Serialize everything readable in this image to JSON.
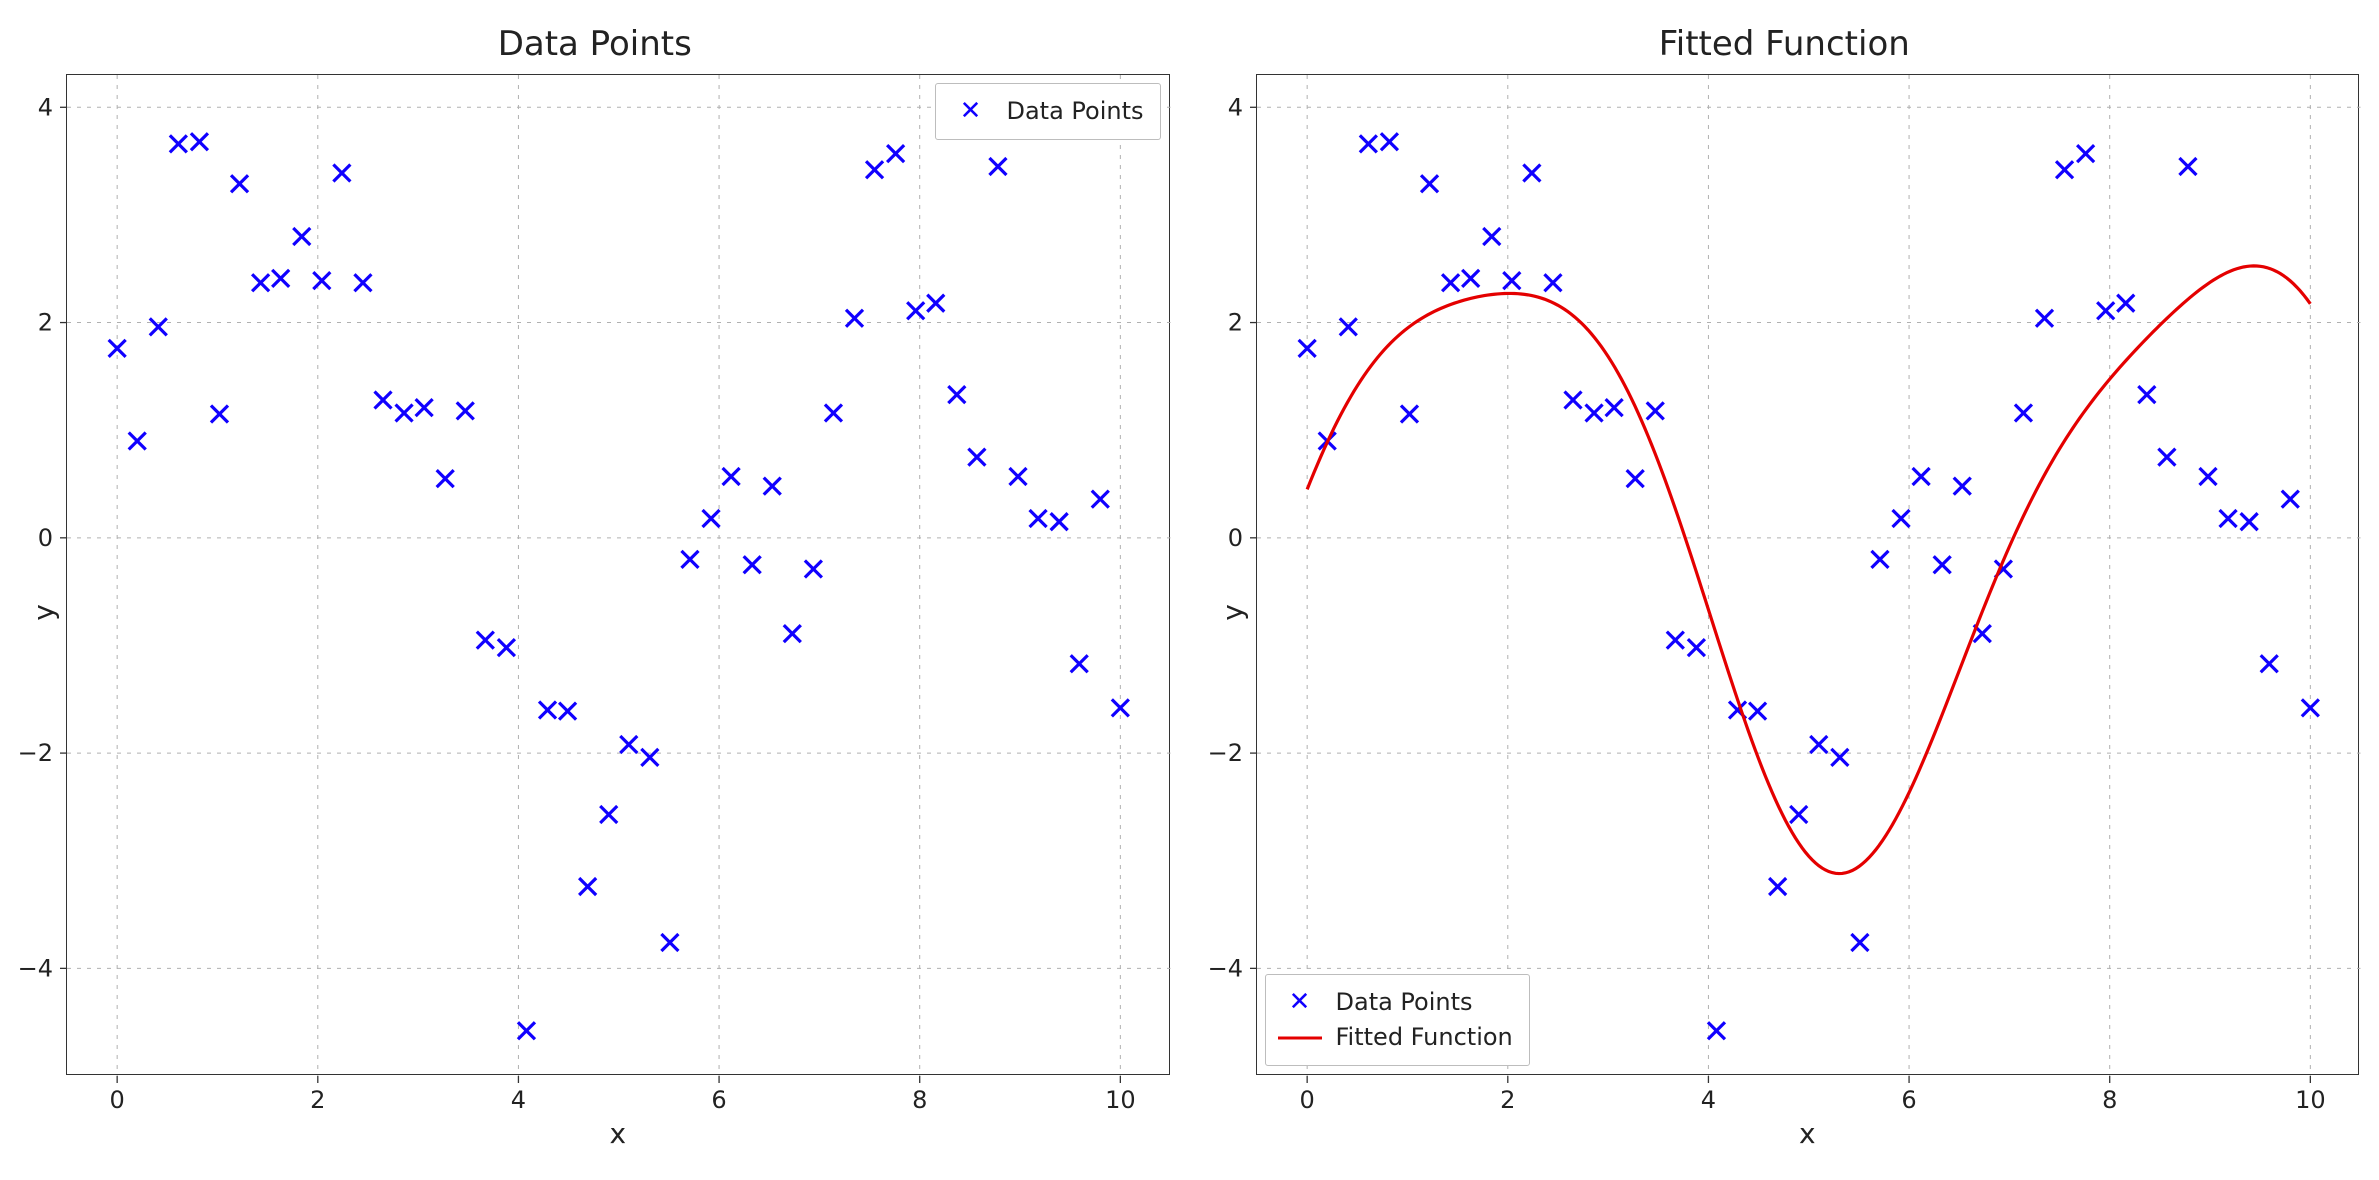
{
  "chart_data": [
    {
      "type": "scatter",
      "title": "Data Points",
      "xlabel": "x",
      "ylabel": "y",
      "xlim": [
        -0.5,
        10.5
      ],
      "ylim": [
        -5.0,
        4.3
      ],
      "xticks": [
        0,
        2,
        4,
        6,
        8,
        10
      ],
      "yticks": [
        -4,
        -2,
        0,
        2,
        4
      ],
      "legend": {
        "position": "upper right",
        "entries": [
          "Data Points"
        ]
      },
      "x": [
        0.0,
        0.2,
        0.41,
        0.61,
        0.82,
        1.02,
        1.22,
        1.43,
        1.63,
        1.84,
        2.04,
        2.24,
        2.45,
        2.65,
        2.86,
        3.06,
        3.27,
        3.47,
        3.67,
        3.88,
        4.08,
        4.29,
        4.49,
        4.69,
        4.9,
        5.1,
        5.31,
        5.51,
        5.71,
        5.92,
        6.12,
        6.33,
        6.53,
        6.73,
        6.94,
        7.14,
        7.35,
        7.55,
        7.76,
        7.96,
        8.16,
        8.37,
        8.57,
        8.78,
        8.98,
        9.18,
        9.39,
        9.59,
        9.8,
        10.0
      ],
      "y": [
        1.76,
        0.9,
        1.96,
        3.66,
        3.68,
        1.15,
        3.29,
        2.37,
        2.41,
        2.8,
        2.39,
        3.39,
        2.37,
        1.28,
        1.16,
        1.21,
        0.55,
        1.18,
        -0.95,
        -1.02,
        -4.58,
        -1.6,
        -1.61,
        -3.24,
        -2.57,
        -1.92,
        -2.04,
        -3.76,
        -0.2,
        0.18,
        0.57,
        -0.25,
        0.48,
        -0.89,
        -0.29,
        1.16,
        2.04,
        3.42,
        3.57,
        2.11,
        2.18,
        1.33,
        0.75,
        3.45,
        0.57,
        0.18,
        0.15,
        -1.17,
        0.36,
        -1.58
      ]
    },
    {
      "type": "scatter+line",
      "title": "Fitted Function",
      "xlabel": "x",
      "ylabel": "y",
      "xlim": [
        -0.5,
        10.5
      ],
      "ylim": [
        -5.0,
        4.3
      ],
      "xticks": [
        0,
        2,
        4,
        6,
        8,
        10
      ],
      "yticks": [
        -4,
        -2,
        0,
        2,
        4
      ],
      "legend": {
        "position": "lower left",
        "entries": [
          "Data Points",
          "Fitted Function"
        ]
      },
      "series": [
        {
          "name": "Data Points",
          "kind": "scatter",
          "x": [
            0.0,
            0.2,
            0.41,
            0.61,
            0.82,
            1.02,
            1.22,
            1.43,
            1.63,
            1.84,
            2.04,
            2.24,
            2.45,
            2.65,
            2.86,
            3.06,
            3.27,
            3.47,
            3.67,
            3.88,
            4.08,
            4.29,
            4.49,
            4.69,
            4.9,
            5.1,
            5.31,
            5.51,
            5.71,
            5.92,
            6.12,
            6.33,
            6.53,
            6.73,
            6.94,
            7.14,
            7.35,
            7.55,
            7.76,
            7.96,
            8.16,
            8.37,
            8.57,
            8.78,
            8.98,
            9.18,
            9.39,
            9.59,
            9.8,
            10.0
          ],
          "y": [
            1.76,
            0.9,
            1.96,
            3.66,
            3.68,
            1.15,
            3.29,
            2.37,
            2.41,
            2.8,
            2.39,
            3.39,
            2.37,
            1.28,
            1.16,
            1.21,
            0.55,
            1.18,
            -0.95,
            -1.02,
            -4.58,
            -1.6,
            -1.61,
            -3.24,
            -2.57,
            -1.92,
            -2.04,
            -3.76,
            -0.2,
            0.18,
            0.57,
            -0.25,
            0.48,
            -0.89,
            -0.29,
            1.16,
            2.04,
            3.42,
            3.57,
            2.11,
            2.18,
            1.33,
            0.75,
            3.45,
            0.57,
            0.18,
            0.15,
            -1.17,
            0.36,
            -1.58
          ]
        },
        {
          "name": "Fitted Function",
          "kind": "line",
          "fit": {
            "form": "a*sin(b*x)+c*cos(d*x)",
            "a": 2.7,
            "b": 0.87,
            "c": 0.45,
            "d": 1.83
          }
        }
      ]
    }
  ],
  "left": {
    "title": "Data Points",
    "xlabel": "x",
    "ylabel": "y",
    "legend_label": "Data Points"
  },
  "right": {
    "title": "Fitted Function",
    "xlabel": "x",
    "ylabel": "y",
    "legend_data_label": "Data Points",
    "legend_fit_label": "Fitted Function"
  }
}
